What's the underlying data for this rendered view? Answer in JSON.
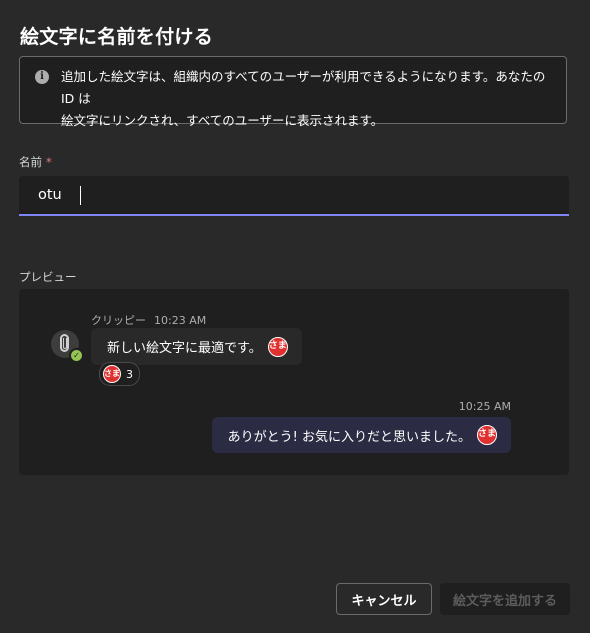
{
  "dialog": {
    "title": "絵文字に名前を付ける"
  },
  "info": {
    "icon": "info-icon",
    "icon_glyph": "i",
    "line1": "追加した絵文字は、組織内のすべてのユーザーが利用できるようになります。あなたの ID は",
    "line2": "絵文字にリンクされ、すべてのユーザーに表示されます。"
  },
  "name_field": {
    "label": "名前",
    "required_mark": "*",
    "value": "otu"
  },
  "preview": {
    "label": "プレビュー",
    "incoming": {
      "sender": "クリッピー",
      "time": "10:23 AM",
      "text": "新しい絵文字に最適です。",
      "emoji_text": "さま",
      "reaction_count": "3",
      "presence": "available",
      "presence_glyph": "✓"
    },
    "outgoing": {
      "time": "10:25 AM",
      "text": "ありがとう! お気に入りだと思いました。",
      "emoji_text": "さま"
    }
  },
  "buttons": {
    "cancel": "キャンセル",
    "add": "絵文字を追加する"
  },
  "colors": {
    "background": "#292929",
    "panel": "#1f1f1f",
    "accent": "#7f85f5",
    "outgoing_bubble": "#2b2c44",
    "required": "#e37d80",
    "presence_available": "#92c353",
    "emoji_red": "#e0302f"
  }
}
